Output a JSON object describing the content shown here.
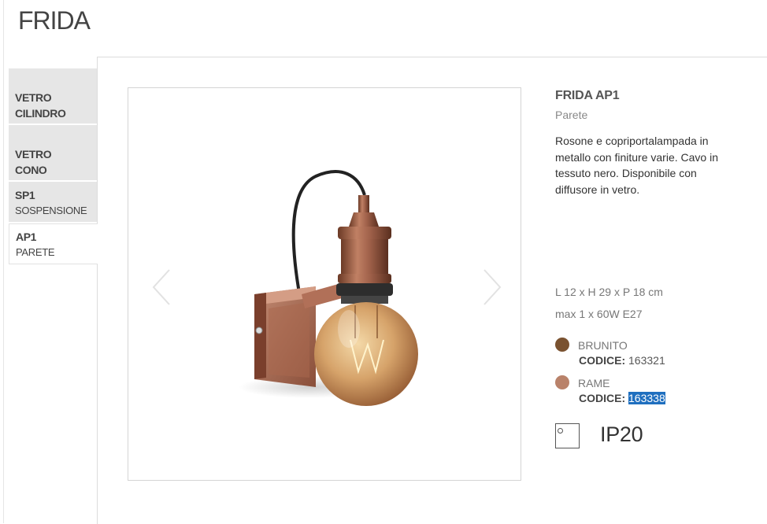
{
  "page": {
    "title": "FRIDA"
  },
  "sidebar": {
    "items": [
      {
        "line1": "VETRO",
        "line2": "CILINDRO",
        "active": false
      },
      {
        "line1": "VETRO",
        "line2": "CONO",
        "active": false
      },
      {
        "line1": "SP1",
        "line2": "SOSPENSIONE",
        "active": false
      },
      {
        "line1": "AP1",
        "line2": "PARETE",
        "active": true
      }
    ]
  },
  "gallery": {
    "prev_icon": "chevron-left-icon",
    "next_icon": "chevron-right-icon"
  },
  "product": {
    "name": "FRIDA AP1",
    "category": "Parete",
    "description": "Rosone e copriportalampada in metallo con finiture varie. Cavo in tessuto nero. Disponibile con diffusore in vetro.",
    "dimensions": "L 12 x H 29 x P 18 cm",
    "power": "max 1 x 60W E27",
    "finishes": [
      {
        "name": "BRUNITO",
        "code_label": "CODICE:",
        "code": "163321",
        "color": "#7a5230",
        "selected": false
      },
      {
        "name": "RAME",
        "code_label": "CODICE:",
        "code": "163338",
        "color": "#b9826a",
        "selected": true
      }
    ],
    "ip_rating": "IP20"
  }
}
